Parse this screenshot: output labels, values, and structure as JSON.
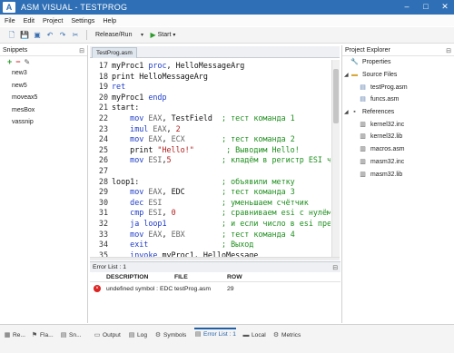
{
  "window": {
    "title": "ASM VISUAL - TESTPROG",
    "logo": "A",
    "controls": [
      "–",
      "□",
      "✕"
    ]
  },
  "menu": [
    "File",
    "Edit",
    "Project",
    "Settings",
    "Help"
  ],
  "toolbar": {
    "icons": [
      "new-file-icon",
      "save-icon",
      "save-all-icon",
      "undo-icon",
      "redo-icon",
      "cut-icon"
    ],
    "config": "Release/Run",
    "start": "Start"
  },
  "snippets": {
    "title": "Snippets",
    "items": [
      "new3",
      "new5",
      "moveax5",
      "mesBox",
      "vassnip"
    ]
  },
  "editor": {
    "tab": "TestProg.asm",
    "lines": [
      {
        "n": "17",
        "segs": [
          {
            "t": "myProc1 ",
            "c": "txt"
          },
          {
            "t": "proc",
            "c": "blue"
          },
          {
            "t": ", HelloMessageArg",
            "c": "txt"
          }
        ]
      },
      {
        "n": "18",
        "segs": [
          {
            "t": "print HelloMessageArg",
            "c": "txt"
          }
        ]
      },
      {
        "n": "19",
        "segs": [
          {
            "t": "ret",
            "c": "blue"
          }
        ]
      },
      {
        "n": "20",
        "segs": [
          {
            "t": "myProc1 ",
            "c": "txt"
          },
          {
            "t": "endp",
            "c": "blue"
          }
        ]
      },
      {
        "n": "21",
        "segs": [
          {
            "t": "start:",
            "c": "txt"
          }
        ]
      },
      {
        "n": "22",
        "segs": [
          {
            "t": "    mov ",
            "c": "blue"
          },
          {
            "t": "EAX",
            "c": "gray"
          },
          {
            "t": ", TestField  ",
            "c": "txt"
          },
          {
            "t": "; тест команда 1",
            "c": "green"
          }
        ]
      },
      {
        "n": "23",
        "segs": [
          {
            "t": "    imul ",
            "c": "blue"
          },
          {
            "t": "EAX",
            "c": "gray"
          },
          {
            "t": ", ",
            "c": "txt"
          },
          {
            "t": "2",
            "c": "num"
          }
        ]
      },
      {
        "n": "24",
        "segs": [
          {
            "t": "    mov ",
            "c": "blue"
          },
          {
            "t": "EAX",
            "c": "gray"
          },
          {
            "t": ", ",
            "c": "txt"
          },
          {
            "t": "ECX",
            "c": "gray"
          },
          {
            "t": "        ",
            "c": "txt"
          },
          {
            "t": "; тест команда 2",
            "c": "green"
          }
        ]
      },
      {
        "n": "25",
        "segs": [
          {
            "t": "    print ",
            "c": "txt"
          },
          {
            "t": "\"Hello!\"",
            "c": "red"
          },
          {
            "t": "       ",
            "c": "txt"
          },
          {
            "t": "; Выводим Hello!",
            "c": "green"
          }
        ]
      },
      {
        "n": "26",
        "segs": [
          {
            "t": "    mov ",
            "c": "blue"
          },
          {
            "t": "ESI",
            "c": "gray"
          },
          {
            "t": ",",
            "c": "txt"
          },
          {
            "t": "5",
            "c": "num"
          },
          {
            "t": "           ",
            "c": "txt"
          },
          {
            "t": "; кладём в регистр ESI ч",
            "c": "green"
          }
        ]
      },
      {
        "n": "27",
        "segs": [
          {
            "t": "",
            "c": "txt"
          }
        ]
      },
      {
        "n": "28",
        "segs": [
          {
            "t": "loop1:",
            "c": "txt"
          },
          {
            "t": "                  ",
            "c": "txt"
          },
          {
            "t": "; объявили метку",
            "c": "green"
          }
        ]
      },
      {
        "n": "29",
        "segs": [
          {
            "t": "    mov ",
            "c": "blue"
          },
          {
            "t": "EAX",
            "c": "gray"
          },
          {
            "t": ", ",
            "c": "txt"
          },
          {
            "t": "EDC",
            "c": "txt"
          },
          {
            "t": "        ",
            "c": "txt"
          },
          {
            "t": "; тест команда 3",
            "c": "green"
          }
        ]
      },
      {
        "n": "30",
        "segs": [
          {
            "t": "    dec ",
            "c": "blue"
          },
          {
            "t": "ESI",
            "c": "gray"
          },
          {
            "t": "             ",
            "c": "txt"
          },
          {
            "t": "; уменьшаем счётчик",
            "c": "green"
          }
        ]
      },
      {
        "n": "31",
        "segs": [
          {
            "t": "    cmp ",
            "c": "blue"
          },
          {
            "t": "ESI",
            "c": "gray"
          },
          {
            "t": ", ",
            "c": "txt"
          },
          {
            "t": "0",
            "c": "num"
          },
          {
            "t": "          ",
            "c": "txt"
          },
          {
            "t": "; сравниваем esi с нулём",
            "c": "green"
          }
        ]
      },
      {
        "n": "32",
        "segs": [
          {
            "t": "    ja loop1",
            "c": "blue"
          },
          {
            "t": "            ",
            "c": "txt"
          },
          {
            "t": "; и если число в esi пре",
            "c": "green"
          }
        ]
      },
      {
        "n": "33",
        "segs": [
          {
            "t": "    mov ",
            "c": "blue"
          },
          {
            "t": "EAX",
            "c": "gray"
          },
          {
            "t": ", ",
            "c": "txt"
          },
          {
            "t": "EBX",
            "c": "gray"
          },
          {
            "t": "        ",
            "c": "txt"
          },
          {
            "t": "; тест команда 4",
            "c": "green"
          }
        ]
      },
      {
        "n": "34",
        "segs": [
          {
            "t": "    exit",
            "c": "blue"
          },
          {
            "t": "                ",
            "c": "txt"
          },
          {
            "t": "; Выход",
            "c": "green"
          }
        ]
      },
      {
        "n": "35",
        "segs": [
          {
            "t": "    invoke ",
            "c": "blue"
          },
          {
            "t": "myProc1, HelloMessage",
            "c": "txt"
          }
        ]
      }
    ]
  },
  "error_list": {
    "title": "Error List : 1",
    "columns": {
      "description": "DESCRIPTION",
      "file": "FILE",
      "row": "ROW"
    },
    "rows": [
      {
        "description": "undefined symbol : EDC",
        "file": "testProg.asm",
        "row": "29"
      }
    ]
  },
  "project_explorer": {
    "title": "Project Explorer",
    "properties": "Properties",
    "source_files": "Source Files",
    "sources": [
      "testProg.asm",
      "funcs.asm"
    ],
    "references": "References",
    "refs": [
      "kernel32.inc",
      "kernel32.lib",
      "macros.asm",
      "masm32.inc",
      "masm32.lib"
    ]
  },
  "bottom_tabs": {
    "left": [
      "Re...",
      "Fla...",
      "Sn..."
    ],
    "main": [
      "Output",
      "Log",
      "Symbols",
      "Error List : 1",
      "Local",
      "Metrics"
    ],
    "active": "Error List : 1"
  }
}
